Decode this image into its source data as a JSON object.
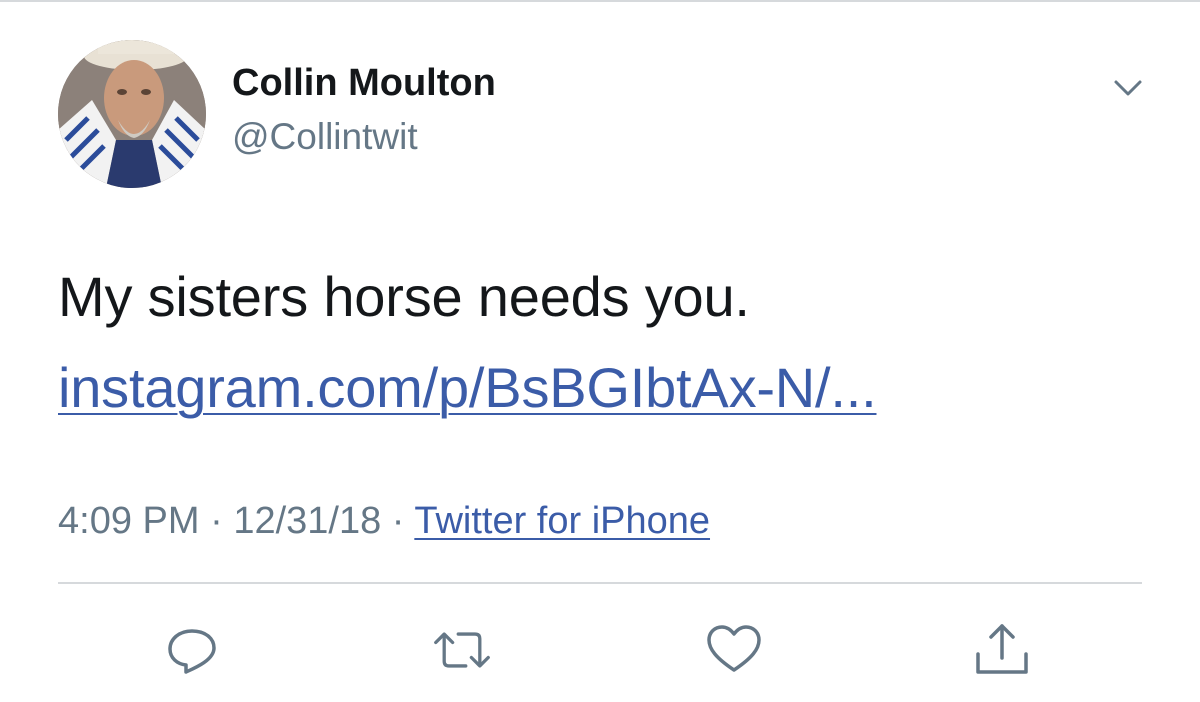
{
  "tweet": {
    "author": {
      "name": "Collin Moulton",
      "handle": "@Collintwit"
    },
    "text": "My sisters horse needs you.",
    "link": "instagram.com/p/BsBGIbtAx-N/...",
    "time": "4:09 PM",
    "separator1": " · ",
    "date": "12/31/18",
    "separator2": " · ",
    "source": "Twitter for iPhone"
  },
  "icons": {
    "more": "chevron-down-icon",
    "reply": "reply-icon",
    "retweet": "retweet-icon",
    "like": "heart-icon",
    "share": "share-icon"
  },
  "colors": {
    "text": "#14171a",
    "secondary": "#657786",
    "link": "#3b5ca8",
    "icon": "#657786",
    "divider": "#d6d9dc"
  }
}
